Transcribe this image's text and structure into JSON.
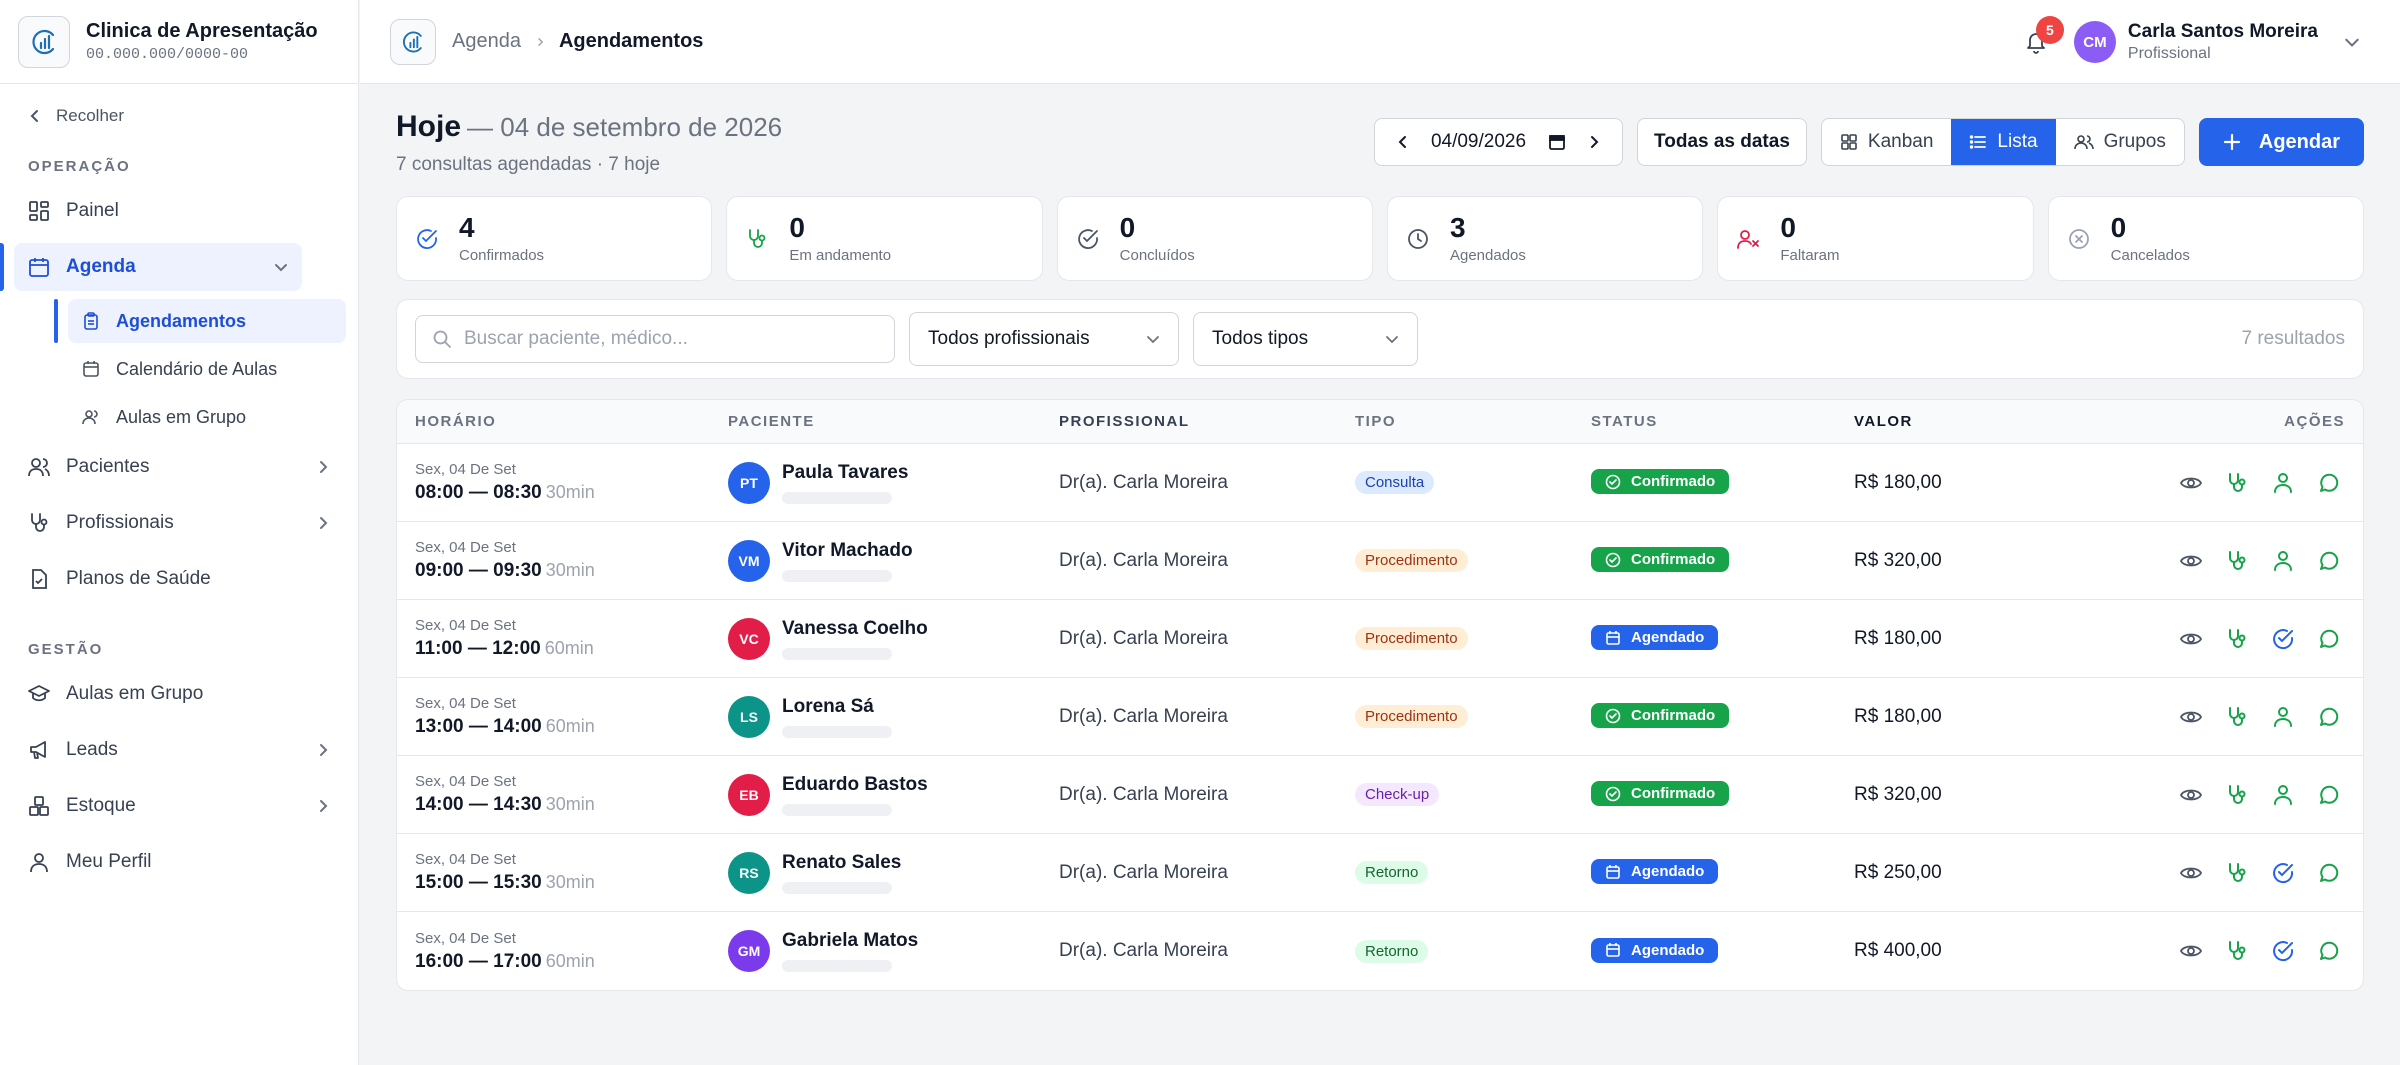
{
  "brand": {
    "name": "Clinica de Apresentação",
    "cnpj": "00.000.000/0000-00"
  },
  "sidebar": {
    "collapse_label": "Recolher",
    "section_operacao": "OPERAÇÃO",
    "section_gestao": "GESTÃO",
    "items": {
      "painel": "Painel",
      "agenda": "Agenda",
      "agendamentos": "Agendamentos",
      "calendario": "Calendário de Aulas",
      "aulas_grupo_sub": "Aulas em Grupo",
      "pacientes": "Pacientes",
      "profissionais": "Profissionais",
      "planos": "Planos de Saúde",
      "aulas_grupo": "Aulas em Grupo",
      "leads": "Leads",
      "estoque": "Estoque",
      "perfil": "Meu Perfil"
    }
  },
  "topbar": {
    "breadcrumb": [
      "Agenda",
      "Agendamentos"
    ],
    "notifications": "5",
    "user": {
      "initials": "CM",
      "name": "Carla Santos Moreira",
      "role": "Profissional"
    }
  },
  "header": {
    "title_bold": "Hoje",
    "title_date": "— 04 de setembro de 2026",
    "subtitle": "7 consultas agendadas · 7 hoje",
    "date_value": "04/09/2026",
    "all_dates": "Todas as datas",
    "views": [
      "Kanban",
      "Lista",
      "Grupos"
    ],
    "active_view": "Lista",
    "new_button": "Agendar"
  },
  "stats": [
    {
      "value": "4",
      "label": "Confirmados",
      "color": "#2563eb"
    },
    {
      "value": "0",
      "label": "Em andamento",
      "color": "#16a34a"
    },
    {
      "value": "0",
      "label": "Concluídos",
      "color": "#4b5563"
    },
    {
      "value": "3",
      "label": "Agendados",
      "color": "#4b5563"
    },
    {
      "value": "0",
      "label": "Faltaram",
      "color": "#e11d48"
    },
    {
      "value": "0",
      "label": "Cancelados",
      "color": "#9ca3af"
    }
  ],
  "filters": {
    "search_placeholder": "Buscar paciente, médico...",
    "professional": "Todos profissionais",
    "type": "Todos tipos",
    "results": "7 resultados"
  },
  "table": {
    "headers": [
      "HORÁRIO",
      "PACIENTE",
      "PROFISSIONAL",
      "TIPO",
      "STATUS",
      "VALOR",
      "AÇÕES"
    ],
    "rows": [
      {
        "day": "Sex, 04 De Set",
        "time": "08:00 — 08:30",
        "duration": "30min",
        "initials": "PT",
        "avatar_color": "#2563eb",
        "patient": "Paula Tavares",
        "professional": "Dr(a). Carla Moreira",
        "type": "Consulta",
        "type_class": "consulta",
        "status": "Confirmado",
        "status_class": "confirmado",
        "value": "R$ 180,00"
      },
      {
        "day": "Sex, 04 De Set",
        "time": "09:00 — 09:30",
        "duration": "30min",
        "initials": "VM",
        "avatar_color": "#2563eb",
        "patient": "Vitor Machado",
        "professional": "Dr(a). Carla Moreira",
        "type": "Procedimento",
        "type_class": "procedimento",
        "status": "Confirmado",
        "status_class": "confirmado",
        "value": "R$ 320,00"
      },
      {
        "day": "Sex, 04 De Set",
        "time": "11:00 — 12:00",
        "duration": "60min",
        "initials": "VC",
        "avatar_color": "#e11d48",
        "patient": "Vanessa Coelho",
        "professional": "Dr(a). Carla Moreira",
        "type": "Procedimento",
        "type_class": "procedimento",
        "status": "Agendado",
        "status_class": "agendado",
        "value": "R$ 180,00"
      },
      {
        "day": "Sex, 04 De Set",
        "time": "13:00 — 14:00",
        "duration": "60min",
        "initials": "LS",
        "avatar_color": "#0d9488",
        "patient": "Lorena Sá",
        "professional": "Dr(a). Carla Moreira",
        "type": "Procedimento",
        "type_class": "procedimento",
        "status": "Confirmado",
        "status_class": "confirmado",
        "value": "R$ 180,00"
      },
      {
        "day": "Sex, 04 De Set",
        "time": "14:00 — 14:30",
        "duration": "30min",
        "initials": "EB",
        "avatar_color": "#e11d48",
        "patient": "Eduardo Bastos",
        "professional": "Dr(a). Carla Moreira",
        "type": "Check-up",
        "type_class": "checkup",
        "status": "Confirmado",
        "status_class": "confirmado",
        "value": "R$ 320,00"
      },
      {
        "day": "Sex, 04 De Set",
        "time": "15:00 — 15:30",
        "duration": "30min",
        "initials": "RS",
        "avatar_color": "#0d9488",
        "patient": "Renato Sales",
        "professional": "Dr(a). Carla Moreira",
        "type": "Retorno",
        "type_class": "retorno",
        "status": "Agendado",
        "status_class": "agendado",
        "value": "R$ 250,00"
      },
      {
        "day": "Sex, 04 De Set",
        "time": "16:00 — 17:00",
        "duration": "60min",
        "initials": "GM",
        "avatar_color": "#7c3aed",
        "patient": "Gabriela Matos",
        "professional": "Dr(a). Carla Moreira",
        "type": "Retorno",
        "type_class": "retorno",
        "status": "Agendado",
        "status_class": "agendado",
        "value": "R$ 400,00"
      }
    ]
  }
}
